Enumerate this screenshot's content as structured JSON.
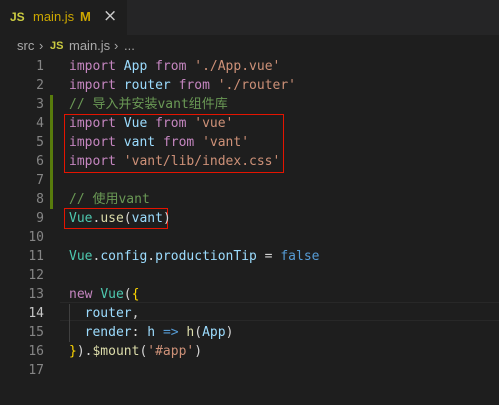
{
  "tab": {
    "badge": "JS",
    "title": "main.js",
    "status": "M",
    "close_glyph": "×"
  },
  "breadcrumb": {
    "folder": "src",
    "sep": "›",
    "badge": "JS",
    "file": "main.js",
    "ellipsis": "..."
  },
  "editor": {
    "lines": [
      {
        "n": "1",
        "tokens": [
          [
            "kw",
            "import"
          ],
          [
            "pl",
            " "
          ],
          [
            "id",
            "App"
          ],
          [
            "pl",
            " "
          ],
          [
            "kw",
            "from"
          ],
          [
            "pl",
            " "
          ],
          [
            "str",
            "'./App.vue'"
          ]
        ]
      },
      {
        "n": "2",
        "tokens": [
          [
            "kw",
            "import"
          ],
          [
            "pl",
            " "
          ],
          [
            "id",
            "router"
          ],
          [
            "pl",
            " "
          ],
          [
            "kw",
            "from"
          ],
          [
            "pl",
            " "
          ],
          [
            "str",
            "'./router'"
          ]
        ]
      },
      {
        "n": "3",
        "tokens": [
          [
            "cmt",
            "// 导入并安装vant组件库"
          ]
        ]
      },
      {
        "n": "4",
        "tokens": [
          [
            "kw",
            "import"
          ],
          [
            "pl",
            " "
          ],
          [
            "id",
            "Vue"
          ],
          [
            "pl",
            " "
          ],
          [
            "kw",
            "from"
          ],
          [
            "pl",
            " "
          ],
          [
            "str",
            "'vue'"
          ]
        ]
      },
      {
        "n": "5",
        "tokens": [
          [
            "kw",
            "import"
          ],
          [
            "pl",
            " "
          ],
          [
            "id",
            "vant"
          ],
          [
            "pl",
            " "
          ],
          [
            "kw",
            "from"
          ],
          [
            "pl",
            " "
          ],
          [
            "str",
            "'vant'"
          ]
        ]
      },
      {
        "n": "6",
        "tokens": [
          [
            "kw",
            "import"
          ],
          [
            "pl",
            " "
          ],
          [
            "str",
            "'vant/lib/index.css'"
          ]
        ]
      },
      {
        "n": "7",
        "tokens": []
      },
      {
        "n": "8",
        "tokens": [
          [
            "cmt",
            "// 使用vant"
          ]
        ]
      },
      {
        "n": "9",
        "tokens": [
          [
            "cls",
            "Vue"
          ],
          [
            "pl",
            "."
          ],
          [
            "fn",
            "use"
          ],
          [
            "pl",
            "("
          ],
          [
            "id",
            "vant"
          ],
          [
            "pl",
            ")"
          ]
        ]
      },
      {
        "n": "10",
        "tokens": []
      },
      {
        "n": "11",
        "tokens": [
          [
            "cls",
            "Vue"
          ],
          [
            "pl",
            "."
          ],
          [
            "id",
            "config"
          ],
          [
            "pl",
            "."
          ],
          [
            "id",
            "productionTip"
          ],
          [
            "pl",
            " = "
          ],
          [
            "bool",
            "false"
          ]
        ]
      },
      {
        "n": "12",
        "tokens": []
      },
      {
        "n": "13",
        "tokens": [
          [
            "kw",
            "new"
          ],
          [
            "pl",
            " "
          ],
          [
            "cls",
            "Vue"
          ],
          [
            "pl",
            "("
          ],
          [
            "br",
            "{"
          ]
        ]
      },
      {
        "n": "14",
        "tokens": [
          [
            "pl",
            "  "
          ],
          [
            "id",
            "router"
          ],
          [
            "pl",
            ","
          ]
        ]
      },
      {
        "n": "15",
        "tokens": [
          [
            "pl",
            "  "
          ],
          [
            "id",
            "render"
          ],
          [
            "pl",
            ": "
          ],
          [
            "id",
            "h"
          ],
          [
            "pl",
            " "
          ],
          [
            "bool",
            "=>"
          ],
          [
            "pl",
            " "
          ],
          [
            "fn",
            "h"
          ],
          [
            "pl",
            "("
          ],
          [
            "id",
            "App"
          ],
          [
            "pl",
            ")"
          ]
        ]
      },
      {
        "n": "16",
        "tokens": [
          [
            "br",
            "}"
          ],
          [
            "pl",
            ")."
          ],
          [
            "fn",
            "$mount"
          ],
          [
            "pl",
            "("
          ],
          [
            "str",
            "'#app'"
          ],
          [
            "pl",
            ")"
          ]
        ]
      },
      {
        "n": "17",
        "tokens": []
      }
    ],
    "active_line": "14"
  },
  "colors": {
    "background": "#1e1e1e",
    "tabbar": "#252526",
    "keyword": "#c586c0",
    "string": "#ce9178",
    "comment": "#6a9955",
    "highlight_box": "#e51400",
    "modified_gutter": "#587c0c"
  }
}
